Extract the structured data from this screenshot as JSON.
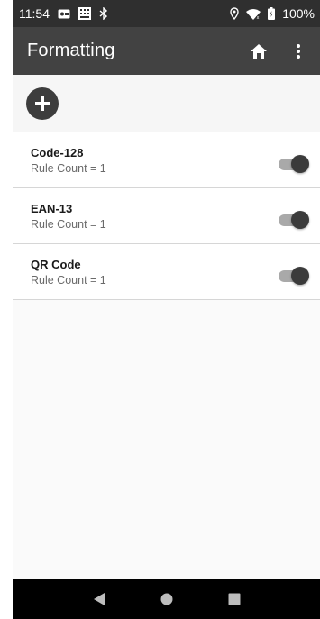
{
  "status_bar": {
    "time": "11:54",
    "battery": "100%",
    "icons": [
      "notification-card-icon",
      "keyboard-icon",
      "bluetooth-icon",
      "location-icon",
      "wifi-icon",
      "battery-icon"
    ]
  },
  "app_bar": {
    "title": "Formatting",
    "icons": [
      "home-icon",
      "more-vert-icon"
    ]
  },
  "add_button": {
    "icon": "add-circle-icon"
  },
  "list": {
    "items": [
      {
        "title": "Code-128",
        "subtitle": "Rule Count = 1",
        "enabled": true
      },
      {
        "title": "EAN-13",
        "subtitle": "Rule Count = 1",
        "enabled": true
      },
      {
        "title": "QR Code",
        "subtitle": "Rule Count = 1",
        "enabled": true
      }
    ]
  },
  "nav_bar": {
    "icons": [
      "back-icon",
      "home-circle-icon",
      "recents-icon"
    ]
  },
  "colors": {
    "status_bar": "#2f2f2f",
    "app_bar": "#424242",
    "fab": "#3d3d3d",
    "toggle_thumb": "#3b3b3b",
    "toggle_track": "#a9a9a9",
    "nav_bar": "#000000"
  }
}
